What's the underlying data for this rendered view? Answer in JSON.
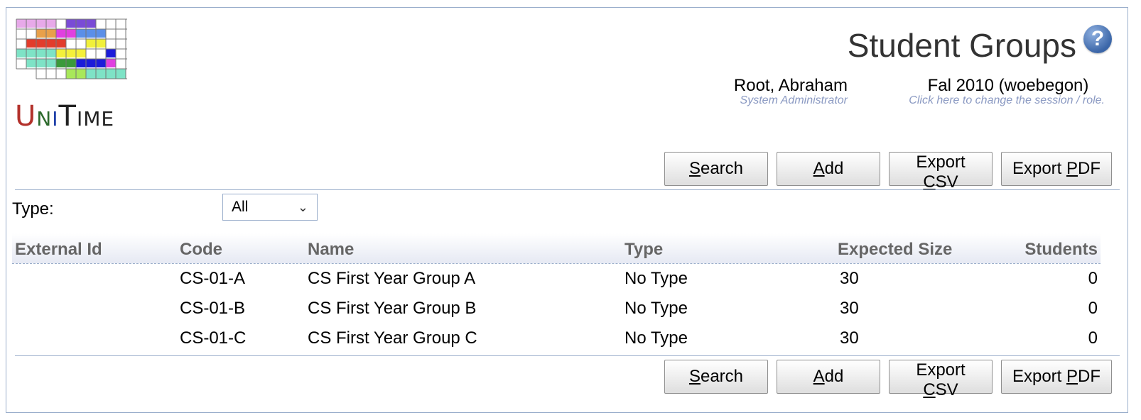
{
  "app": {
    "logo_text": "UniTime"
  },
  "header": {
    "title": "Student Groups",
    "user": {
      "name": "Root, Abraham",
      "role": "System Administrator"
    },
    "session": {
      "name": "Fal 2010 (woebegon)",
      "hint": "Click here to change the session / role."
    }
  },
  "toolbar": {
    "search": {
      "pre": "",
      "key": "S",
      "post": "earch"
    },
    "add": {
      "pre": "",
      "key": "A",
      "post": "dd"
    },
    "export_csv": {
      "pre": "Export ",
      "key": "C",
      "post": "SV"
    },
    "export_pdf": {
      "pre": "Export ",
      "key": "P",
      "post": "DF"
    }
  },
  "filter": {
    "type_label": "Type:",
    "type_value": "All"
  },
  "table": {
    "columns": [
      "External Id",
      "Code",
      "Name",
      "Type",
      "Expected Size",
      "Students"
    ],
    "rows": [
      {
        "external_id": "",
        "code": "CS-01-A",
        "name": "CS First Year Group A",
        "type": "No Type",
        "expected_size": "30",
        "students": "0"
      },
      {
        "external_id": "",
        "code": "CS-01-B",
        "name": "CS First Year Group B",
        "type": "No Type",
        "expected_size": "30",
        "students": "0"
      },
      {
        "external_id": "",
        "code": "CS-01-C",
        "name": "CS First Year Group C",
        "type": "No Type",
        "expected_size": "30",
        "students": "0"
      }
    ]
  },
  "colors": {
    "accent_border": "#9aaecb",
    "hint_text": "#8a99c2"
  }
}
